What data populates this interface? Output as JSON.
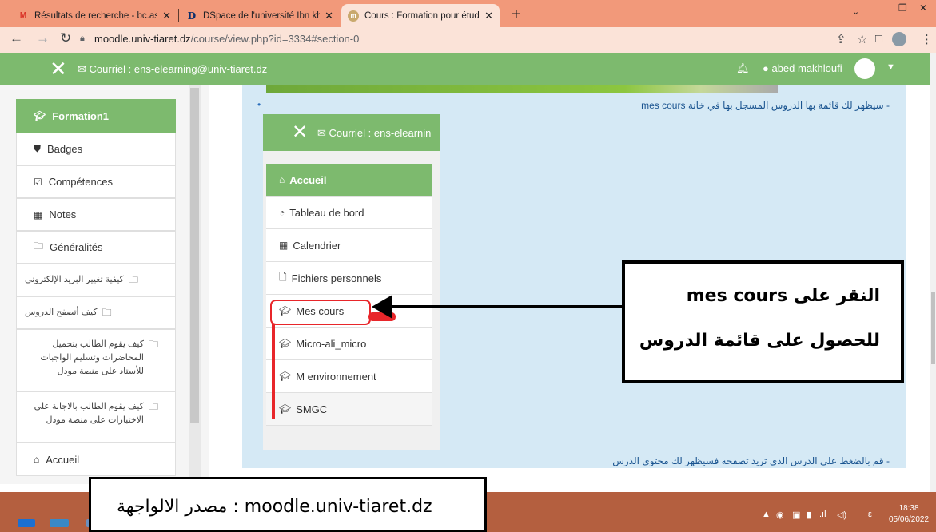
{
  "browser": {
    "tabs": [
      {
        "label": "Résultats de recherche - bc.assist",
        "favicon": "M",
        "active": false
      },
      {
        "label": "DSpace de l'université Ibn khaldo",
        "favicon": "D",
        "active": false
      },
      {
        "label": "Cours : Formation pour étudiant",
        "favicon": "moodle-icon",
        "active": true
      }
    ],
    "new_tab": "+",
    "url_host": "moodle.univ-tiaret.dz",
    "url_path": "/course/view.php?id=3334#section-0",
    "tabstrip_color": "#f2997a"
  },
  "navbar": {
    "email_label": "Courriel : ens-elearning@univ-tiaret.dz",
    "user_name": "abed makhloufi",
    "brand_color": "#7dba6e"
  },
  "sidebar": {
    "header": "Formation1",
    "items": [
      {
        "label": "Badges",
        "icon": "shield-icon"
      },
      {
        "label": "Compétences",
        "icon": "check-square-icon"
      },
      {
        "label": "Notes",
        "icon": "table-icon"
      },
      {
        "label": "Généralités",
        "icon": "folder-icon"
      },
      {
        "label": "كيفية تغيير البريد الإلكتروني",
        "icon": "folder-icon"
      },
      {
        "label": "كيف أتصفح الدروس",
        "icon": "folder-icon"
      },
      {
        "label": "كيف يقوم الطالب بتحميل المحاضرات وتسليم الواجبات للأستاذ على منصة مودل",
        "icon": "folder-icon"
      },
      {
        "label": "كيف يقوم الطالب بالاجابة على الاختبارات على منصة مودل",
        "icon": "folder-icon"
      },
      {
        "label": "Accueil",
        "icon": "home-icon"
      }
    ]
  },
  "content": {
    "top_text": "- سيظهر لك قائمة بها الدروس المسجل بها في خانة mes cours",
    "bottom_text": "- قم بالضغط على الدرس الذي تريد تصفحه فسيظهر لك محتوى الدرس",
    "inner_email": "Courriel : ens-elearnin",
    "inner_menu": [
      {
        "label": "Accueil",
        "icon": "home-icon"
      },
      {
        "label": "Tableau de bord",
        "icon": "dashboard-icon"
      },
      {
        "label": "Calendrier",
        "icon": "calendar-icon"
      },
      {
        "label": "Fichiers personnels",
        "icon": "file-icon"
      },
      {
        "label": "Mes cours",
        "icon": "graduation-cap-icon"
      },
      {
        "label": "Micro-ali_micro",
        "icon": "graduation-cap-icon"
      },
      {
        "label": "M environnement",
        "icon": "graduation-cap-icon"
      },
      {
        "label": "SMGC",
        "icon": "graduation-cap-icon"
      }
    ]
  },
  "callout": {
    "line1": "النقر على mes cours",
    "line2": "للحصول على قائمة الدروس"
  },
  "source_caption": "مصدر الالواجهة : moodle.univ-tiaret.dz",
  "taskbar": {
    "time": "18:38",
    "date": "05/06/2022",
    "lang": "ε"
  }
}
